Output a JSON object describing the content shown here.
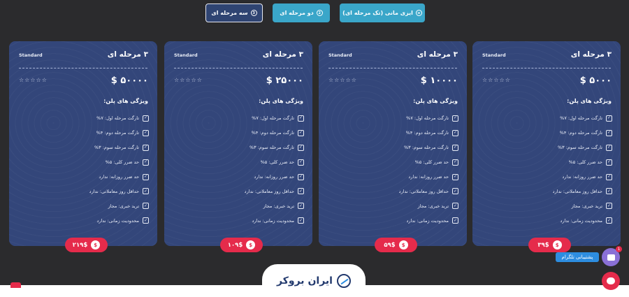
{
  "tabs": [
    {
      "label": "ایزی مانی (تک مرحله ای)",
      "icon": "bars-icon"
    },
    {
      "label": "دو مرحله ای",
      "icon": "2-circle-icon",
      "icon_text": "2"
    },
    {
      "label": "سه مرحله ای",
      "icon": "3-circle-icon",
      "icon_text": "3"
    }
  ],
  "plans": [
    {
      "title": "۳ مرحله ای",
      "badge": "Standard",
      "price": "$ ۵۰۰۰",
      "stars": "☆☆☆☆☆",
      "features_title": "ویژگی های پلن:",
      "features": [
        "تارگت مرحله اول: ۷%",
        "تارگت مرحله دوم: ۴%",
        "تارگت مرحله سوم: ۳%",
        "حد ضرر کلی: ۵%",
        "حد ضرر روزانه: ندارد",
        "حداقل روز معاملاتی: ندارد",
        "ترید خبری: مجاز",
        "محدودیت زمانی: ندارد"
      ],
      "cost": "۳۹$"
    },
    {
      "title": "۳ مرحله ای",
      "badge": "Standard",
      "price": "$ ۱۰۰۰۰",
      "stars": "☆☆☆☆☆",
      "features_title": "ویژگی های پلن:",
      "features": [
        "تارگت مرحله اول: ۷%",
        "تارگت مرحله دوم: ۴%",
        "تارگت مرحله سوم: ۳%",
        "حد ضرر کلی: ۵%",
        "حد ضرر روزانه: ندارد",
        "حداقل روز معاملاتی: ندارد",
        "ترید خبری: مجاز",
        "محدودیت زمانی: ندارد"
      ],
      "cost": "۵۹$"
    },
    {
      "title": "۳ مرحله ای",
      "badge": "Standard",
      "price": "$ ۲۵۰۰۰",
      "stars": "☆☆☆☆☆",
      "features_title": "ویژگی های پلن:",
      "features": [
        "تارگت مرحله اول: ۷%",
        "تارگت مرحله دوم: ۴%",
        "تارگت مرحله سوم: ۳%",
        "حد ضرر کلی: ۵%",
        "حد ضرر روزانه: ندارد",
        "حداقل روز معاملاتی: ندارد",
        "ترید خبری: مجاز",
        "محدودیت زمانی: ندارد"
      ],
      "cost": "۱۰۹$"
    },
    {
      "title": "۳ مرحله ای",
      "badge": "Standard",
      "price": "$ ۵۰۰۰۰",
      "stars": "☆☆☆☆☆",
      "features_title": "ویژگی های پلن:",
      "features": [
        "تارگت مرحله اول: ۷%",
        "تارگت مرحله دوم: ۴%",
        "تارگت مرحله سوم: ۳%",
        "حد ضرر کلی: ۵%",
        "حد ضرر روزانه: ندارد",
        "حداقل روز معاملاتی: ندارد",
        "ترید خبری: مجاز",
        "محدودیت زمانی: ندارد"
      ],
      "cost": "۲۱۹$"
    }
  ],
  "logo": {
    "text": "ایران بروکر",
    "icon": "trend-arrow-icon"
  },
  "support": {
    "label": "پشتیبانی تلگرام",
    "badge": "1",
    "chat_icon": "chat-bubble-icon",
    "help_icon": "help-chat-icon"
  },
  "colors": {
    "background": "#2b2b2d",
    "card": "#33467a",
    "accent_blue": "#3aa6c9",
    "accent_red": "#e52b4b",
    "active_tab": "#2f4472"
  }
}
